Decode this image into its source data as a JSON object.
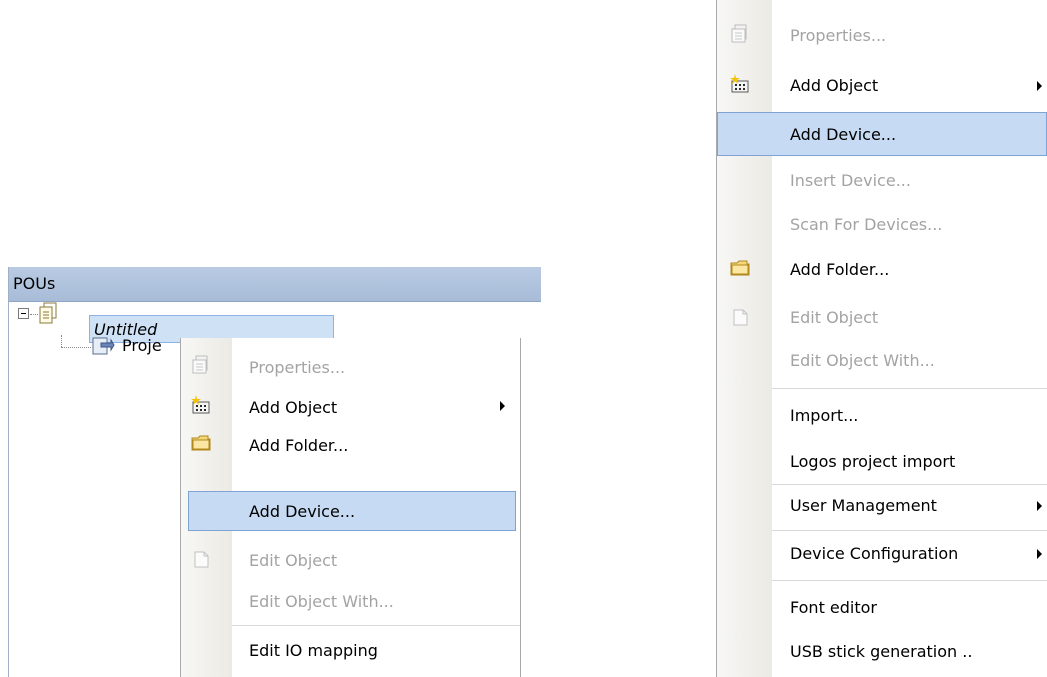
{
  "pous_panel": {
    "title": "POUs",
    "tree": {
      "root_label": "Untitled",
      "child_label": "Proje"
    }
  },
  "left_menu": {
    "items": [
      {
        "label": "Properties...",
        "icon": "properties-icon",
        "disabled": true
      },
      {
        "label": "Add Object",
        "icon": "add-object-icon",
        "submenu": true
      },
      {
        "label": "Add Folder...",
        "icon": "folder-icon"
      },
      {
        "label": "Add Device...",
        "selected": true
      },
      {
        "label": "Edit Object",
        "icon": "edit-object-icon",
        "disabled": true
      },
      {
        "label": "Edit Object With...",
        "disabled": true
      },
      {
        "label": "Edit IO mapping"
      }
    ]
  },
  "right_menu": {
    "items": [
      {
        "label": "Properties...",
        "icon": "properties-icon",
        "disabled": true
      },
      {
        "label": "Add Object",
        "icon": "add-object-icon",
        "submenu": true
      },
      {
        "label": "Add Device...",
        "selected": true
      },
      {
        "label": "Insert Device...",
        "disabled": true
      },
      {
        "label": "Scan For Devices...",
        "disabled": true
      },
      {
        "label": "Add Folder...",
        "icon": "folder-icon"
      },
      {
        "label": "Edit Object",
        "icon": "edit-object-icon",
        "disabled": true
      },
      {
        "label": "Edit Object With...",
        "disabled": true
      },
      {
        "label": "Import..."
      },
      {
        "label": "Logos project import"
      },
      {
        "label": "User Management",
        "submenu": true
      },
      {
        "label": "Device Configuration",
        "submenu": true
      },
      {
        "label": "Font editor"
      },
      {
        "label": "USB stick generation .."
      }
    ]
  },
  "colors": {
    "selection_fill": "#c6daf3",
    "selection_border": "#7fa4d4",
    "header_bg": "#b0c3de",
    "disabled_text": "#a3a3a3"
  }
}
